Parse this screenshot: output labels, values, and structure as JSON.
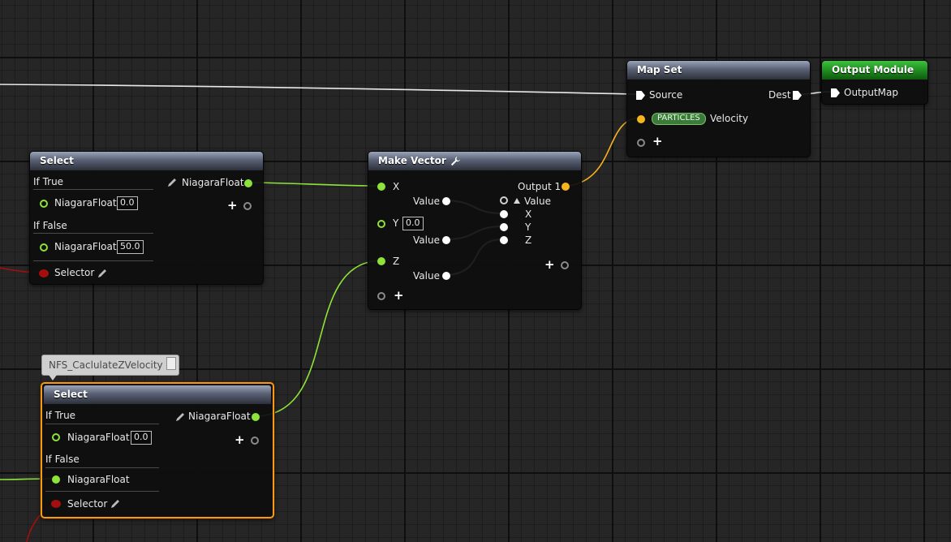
{
  "nodes": {
    "map_set": {
      "title": "Map Set",
      "source_label": "Source",
      "dest_label": "Dest",
      "namespace_badge": "PARTICLES",
      "velocity_label": "Velocity"
    },
    "output_module": {
      "title": "Output Module",
      "output_map_label": "OutputMap"
    },
    "select_top": {
      "title": "Select",
      "if_true_label": "If True",
      "if_true_type": "NiagaraFloat",
      "if_true_value": "0.0",
      "if_false_label": "If False",
      "if_false_type": "NiagaraFloat",
      "if_false_value": "50.0",
      "selector_label": "Selector",
      "output_type": "NiagaraFloat"
    },
    "make_vector": {
      "title": "Make Vector",
      "x_label": "X",
      "y_label": "Y",
      "y_value": "0.0",
      "z_label": "Z",
      "value_label": "Value",
      "output_label": "Output 1",
      "out_value_label": "Value",
      "out_x": "X",
      "out_y": "Y",
      "out_z": "Z"
    },
    "select_bottom": {
      "title": "Select",
      "comment": "NFS_CaclulateZVelocity",
      "if_true_label": "If True",
      "if_true_type": "NiagaraFloat",
      "if_true_value": "0.0",
      "if_false_label": "If False",
      "if_false_type": "NiagaraFloat",
      "selector_label": "Selector",
      "output_type": "NiagaraFloat"
    }
  },
  "colors": {
    "float_pin": "#8ee33a",
    "vector_pin": "#f6b41e",
    "bool_pin": "#a30f0f",
    "selected_outline": "#f49a18",
    "output_header": "#1d8a1d"
  },
  "icons": [
    "exec-pin-icon",
    "pencil-icon",
    "wrench-icon",
    "add-pin-icon",
    "collapse-triangle-icon",
    "comment-icon"
  ]
}
